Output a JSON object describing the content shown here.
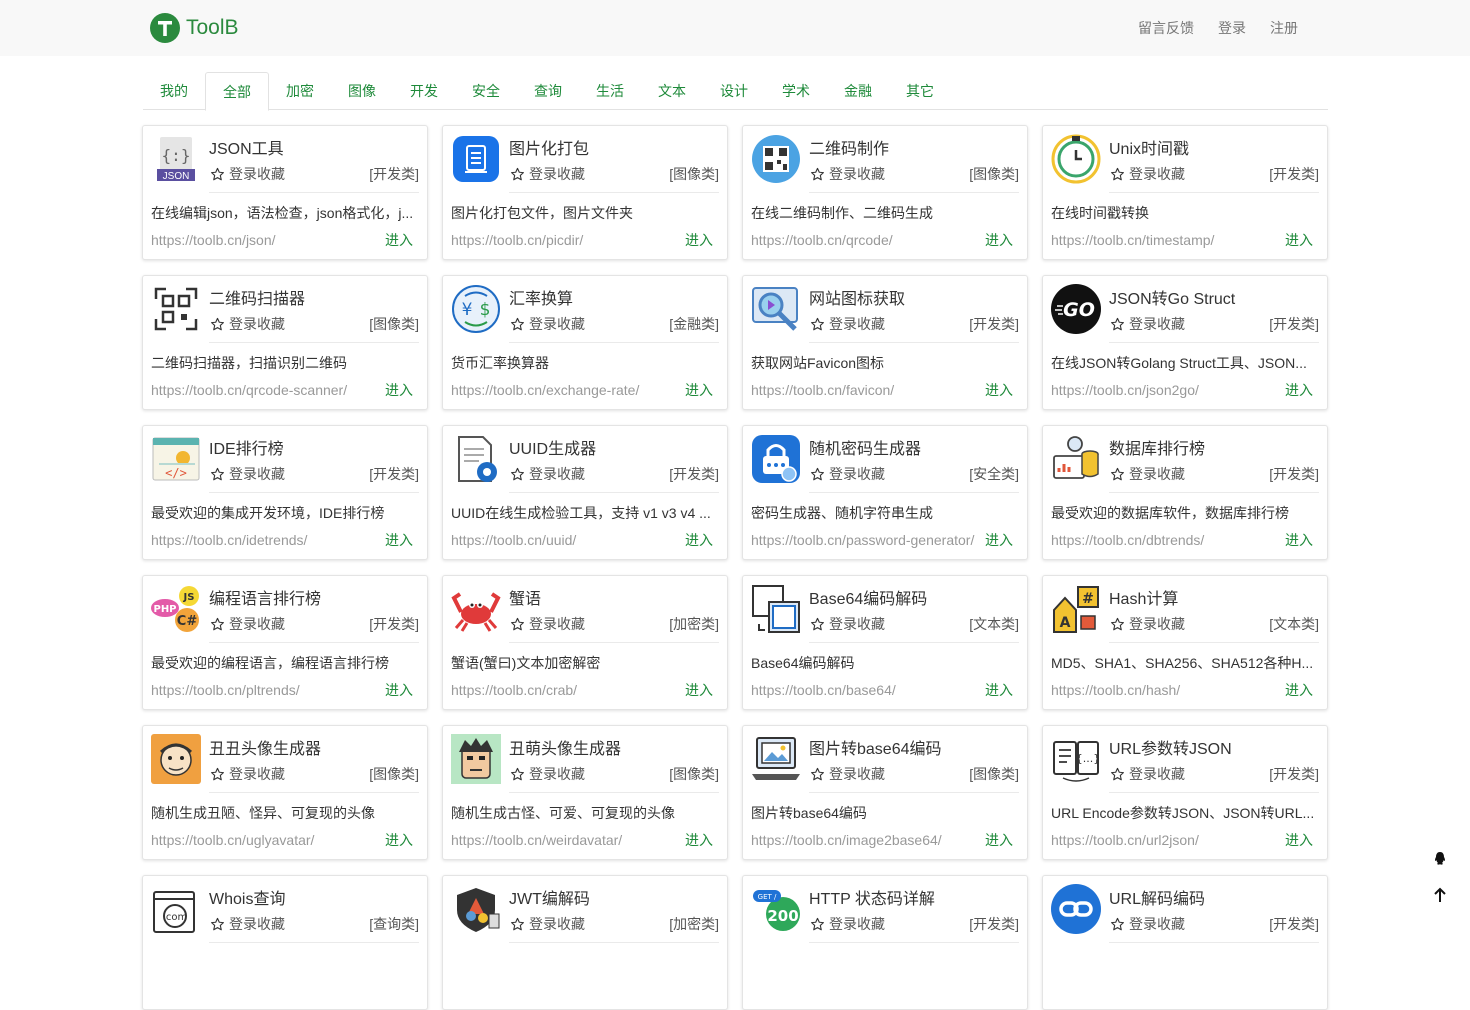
{
  "brand": {
    "name": "ToolB",
    "accent": "#2b8a3e"
  },
  "topnav": {
    "feedback": "留言反馈",
    "login": "登录",
    "register": "注册"
  },
  "tabs": [
    "我的",
    "全部",
    "加密",
    "图像",
    "开发",
    "安全",
    "查询",
    "生活",
    "文本",
    "设计",
    "学术",
    "金融",
    "其它"
  ],
  "active_tab": "全部",
  "fav_label": "登录收藏",
  "enter_label": "进入",
  "cards": [
    {
      "title": "JSON工具",
      "cat": "[开发类]",
      "desc": "在线编辑json，语法检查，json格式化，j...",
      "url": "https://toolb.cn/json/",
      "icon": "json-icon"
    },
    {
      "title": "图片化打包",
      "cat": "[图像类]",
      "desc": "图片化打包文件，图片文件夹",
      "url": "https://toolb.cn/picdir/",
      "icon": "document-icon"
    },
    {
      "title": "二维码制作",
      "cat": "[图像类]",
      "desc": "在线二维码制作、二维码生成",
      "url": "https://toolb.cn/qrcode/",
      "icon": "qrcode-icon"
    },
    {
      "title": "Unix时间戳",
      "cat": "[开发类]",
      "desc": "在线时间戳转换",
      "url": "https://toolb.cn/timestamp/",
      "icon": "clock-icon"
    },
    {
      "title": "二维码扫描器",
      "cat": "[图像类]",
      "desc": "二维码扫描器，扫描识别二维码",
      "url": "https://toolb.cn/qrcode-scanner/",
      "icon": "qr-scanner-icon"
    },
    {
      "title": "汇率换算",
      "cat": "[金融类]",
      "desc": "货币汇率换算器",
      "url": "https://toolb.cn/exchange-rate/",
      "icon": "currency-exchange-icon"
    },
    {
      "title": "网站图标获取",
      "cat": "[开发类]",
      "desc": "获取网站Favicon图标",
      "url": "https://toolb.cn/favicon/",
      "icon": "favicon-search-icon"
    },
    {
      "title": "JSON转Go Struct",
      "cat": "[开发类]",
      "desc": "在线JSON转Golang Struct工具、JSON...",
      "url": "https://toolb.cn/json2go/",
      "icon": "go-icon"
    },
    {
      "title": "IDE排行榜",
      "cat": "[开发类]",
      "desc": "最受欢迎的集成开发环境，IDE排行榜",
      "url": "https://toolb.cn/idetrends/",
      "icon": "ide-icon"
    },
    {
      "title": "UUID生成器",
      "cat": "[开发类]",
      "desc": "UUID在线生成检验工具，支持 v1 v3 v4 ...",
      "url": "https://toolb.cn/uuid/",
      "icon": "uuid-icon"
    },
    {
      "title": "随机密码生成器",
      "cat": "[安全类]",
      "desc": "密码生成器、随机字符串生成",
      "url": "https://toolb.cn/password-generator/",
      "icon": "password-lock-icon"
    },
    {
      "title": "数据库排行榜",
      "cat": "[开发类]",
      "desc": "最受欢迎的数据库软件，数据库排行榜",
      "url": "https://toolb.cn/dbtrends/",
      "icon": "database-icon"
    },
    {
      "title": "编程语言排行榜",
      "cat": "[开发类]",
      "desc": "最受欢迎的编程语言，编程语言排行榜",
      "url": "https://toolb.cn/pltrends/",
      "icon": "programming-languages-icon"
    },
    {
      "title": "蟹语",
      "cat": "[加密类]",
      "desc": "蟹语(蟹曰)文本加密解密",
      "url": "https://toolb.cn/crab/",
      "icon": "crab-icon"
    },
    {
      "title": "Base64编码解码",
      "cat": "[文本类]",
      "desc": "Base64编码解码",
      "url": "https://toolb.cn/base64/",
      "icon": "base64-icon"
    },
    {
      "title": "Hash计算",
      "cat": "[文本类]",
      "desc": "MD5、SHA1、SHA256、SHA512各种H...",
      "url": "https://toolb.cn/hash/",
      "icon": "hash-icon"
    },
    {
      "title": "丑丑头像生成器",
      "cat": "[图像类]",
      "desc": "随机生成丑陋、怪异、可复现的头像",
      "url": "https://toolb.cn/uglyavatar/",
      "icon": "ugly-avatar-icon"
    },
    {
      "title": "丑萌头像生成器",
      "cat": "[图像类]",
      "desc": "随机生成古怪、可爱、可复现的头像",
      "url": "https://toolb.cn/weirdavatar/",
      "icon": "weird-avatar-icon"
    },
    {
      "title": "图片转base64编码",
      "cat": "[图像类]",
      "desc": "图片转base64编码",
      "url": "https://toolb.cn/image2base64/",
      "icon": "image-laptop-icon"
    },
    {
      "title": "URL参数转JSON",
      "cat": "[开发类]",
      "desc": "URL Encode参数转JSON、JSON转URL...",
      "url": "https://toolb.cn/url2json/",
      "icon": "url-json-icon"
    },
    {
      "title": "Whois查询",
      "cat": "[查询类]",
      "desc": "",
      "url": "",
      "icon": "whois-icon"
    },
    {
      "title": "JWT编解码",
      "cat": "[加密类]",
      "desc": "",
      "url": "",
      "icon": "jwt-icon"
    },
    {
      "title": "HTTP 状态码详解",
      "cat": "[开发类]",
      "desc": "",
      "url": "",
      "icon": "http-status-icon",
      "badge_top": "GET /",
      "badge_num": "200"
    },
    {
      "title": "URL解码编码",
      "cat": "[开发类]",
      "desc": "",
      "url": "",
      "icon": "link-icon"
    }
  ]
}
